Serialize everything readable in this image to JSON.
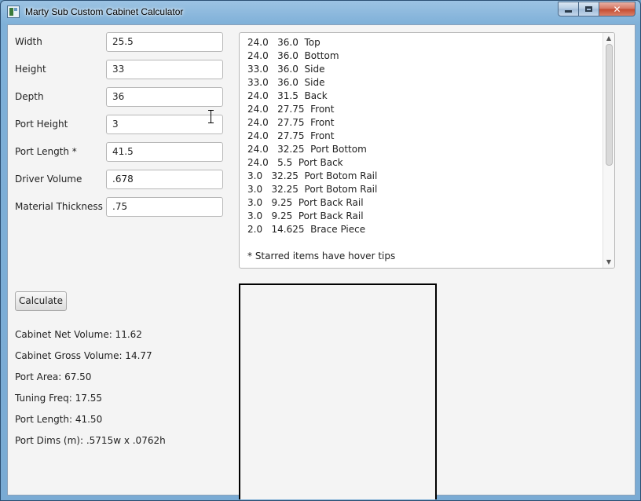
{
  "window": {
    "title": "Marty Sub Custom Cabinet Calculator",
    "controls": {
      "minimize": "",
      "maximize": "",
      "close": "✕"
    }
  },
  "fields": [
    {
      "label": "Width",
      "value": "25.5"
    },
    {
      "label": "Height",
      "value": "33"
    },
    {
      "label": "Depth",
      "value": "36"
    },
    {
      "label": "Port Height",
      "value": "3"
    },
    {
      "label": "Port Length *",
      "value": "41.5"
    },
    {
      "label": "Driver Volume",
      "value": ".678"
    },
    {
      "label": "Material Thickness *",
      "value": ".75"
    }
  ],
  "cut_list": [
    "24.0   36.0  Top",
    "24.0   36.0  Bottom",
    "33.0   36.0  Side",
    "33.0   36.0  Side",
    "24.0   31.5  Back",
    "24.0   27.75  Front",
    "24.0   27.75  Front",
    "24.0   27.75  Front",
    "24.0   32.25  Port Bottom",
    "24.0   5.5  Port Back",
    "3.0   32.25  Port Botom Rail",
    "3.0   32.25  Port Botom Rail",
    "3.0   9.25  Port Back Rail",
    "3.0   9.25  Port Back Rail",
    "2.0   14.625  Brace Piece"
  ],
  "cut_list_note": "* Starred items have hover tips",
  "calculate_label": "Calculate",
  "results": [
    "Cabinet Net Volume: 11.62",
    "Cabinet Gross Volume: 14.77",
    "Port Area: 67.50",
    "Tuning Freq: 17.55",
    "Port Length: 41.50",
    "Port Dims (m): .5715w x .0762h"
  ],
  "scroll_arrows": {
    "up": "▲",
    "down": "▼"
  }
}
